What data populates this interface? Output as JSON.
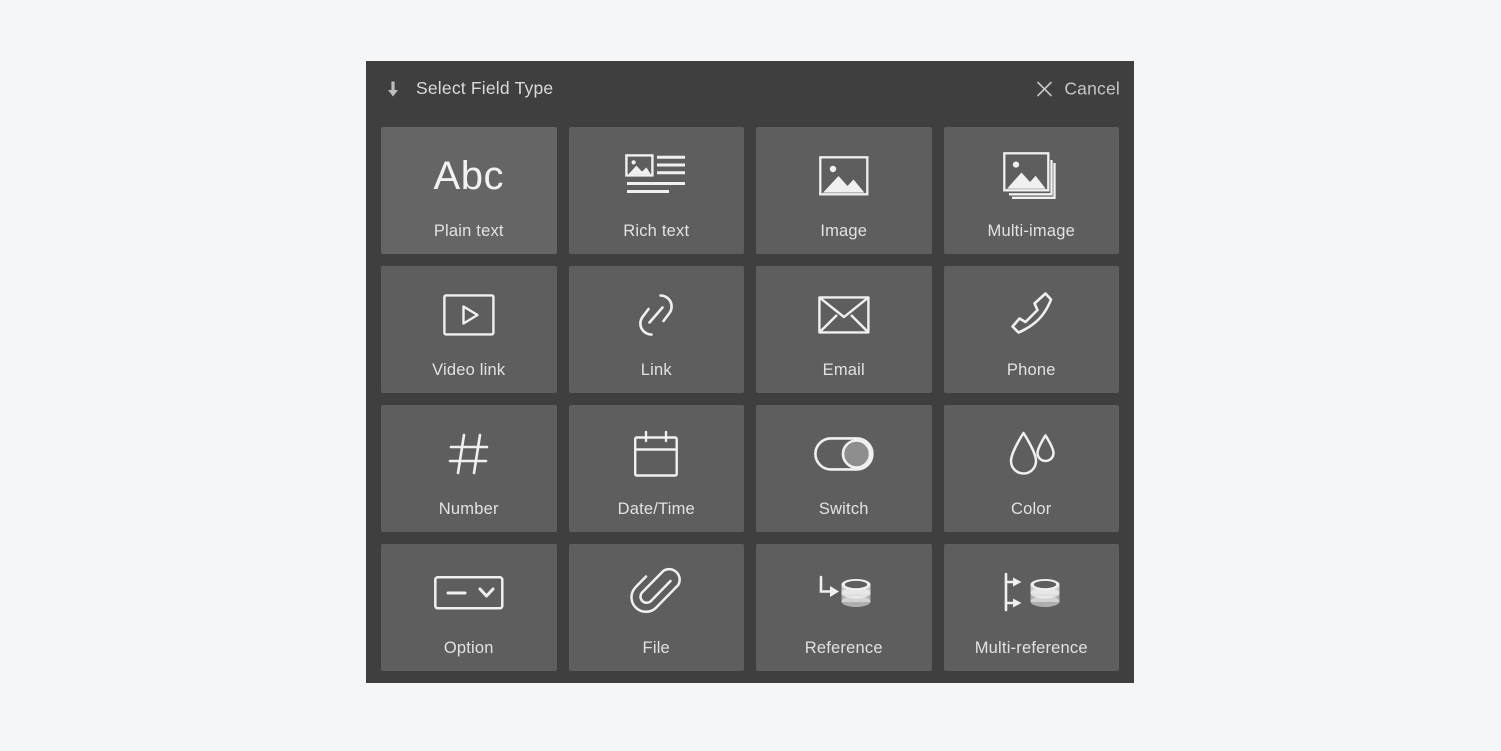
{
  "page": {
    "background_color": "#f4f6f8",
    "panel_color": "#3f3f3f",
    "tile_color": "#5e5e5e",
    "tile_selected_color": "#656565",
    "icon_color": "#f0f0f0",
    "text_color": "#e2e2e2"
  },
  "header": {
    "title": "Select Field Type",
    "arrow_icon": "arrow-down-icon",
    "cancel_label": "Cancel",
    "cancel_icon": "close-icon"
  },
  "field_types": [
    {
      "label": "Plain text",
      "icon": "abc-text-icon",
      "selected": true
    },
    {
      "label": "Rich text",
      "icon": "rich-text-icon",
      "selected": false
    },
    {
      "label": "Image",
      "icon": "image-icon",
      "selected": false
    },
    {
      "label": "Multi-image",
      "icon": "multi-image-icon",
      "selected": false
    },
    {
      "label": "Video link",
      "icon": "video-play-icon",
      "selected": false
    },
    {
      "label": "Link",
      "icon": "chain-link-icon",
      "selected": false
    },
    {
      "label": "Email",
      "icon": "envelope-icon",
      "selected": false
    },
    {
      "label": "Phone",
      "icon": "phone-handset-icon",
      "selected": false
    },
    {
      "label": "Number",
      "icon": "hash-icon",
      "selected": false
    },
    {
      "label": "Date/Time",
      "icon": "calendar-icon",
      "selected": false
    },
    {
      "label": "Switch",
      "icon": "toggle-switch-icon",
      "selected": false
    },
    {
      "label": "Color",
      "icon": "droplet-icon",
      "selected": false
    },
    {
      "label": "Option",
      "icon": "dropdown-select-icon",
      "selected": false
    },
    {
      "label": "File",
      "icon": "paperclip-icon",
      "selected": false
    },
    {
      "label": "Reference",
      "icon": "database-arrow-icon",
      "selected": false
    },
    {
      "label": "Multi-reference",
      "icon": "database-branch-icon",
      "selected": false
    }
  ],
  "abc_glyph": "Abc"
}
